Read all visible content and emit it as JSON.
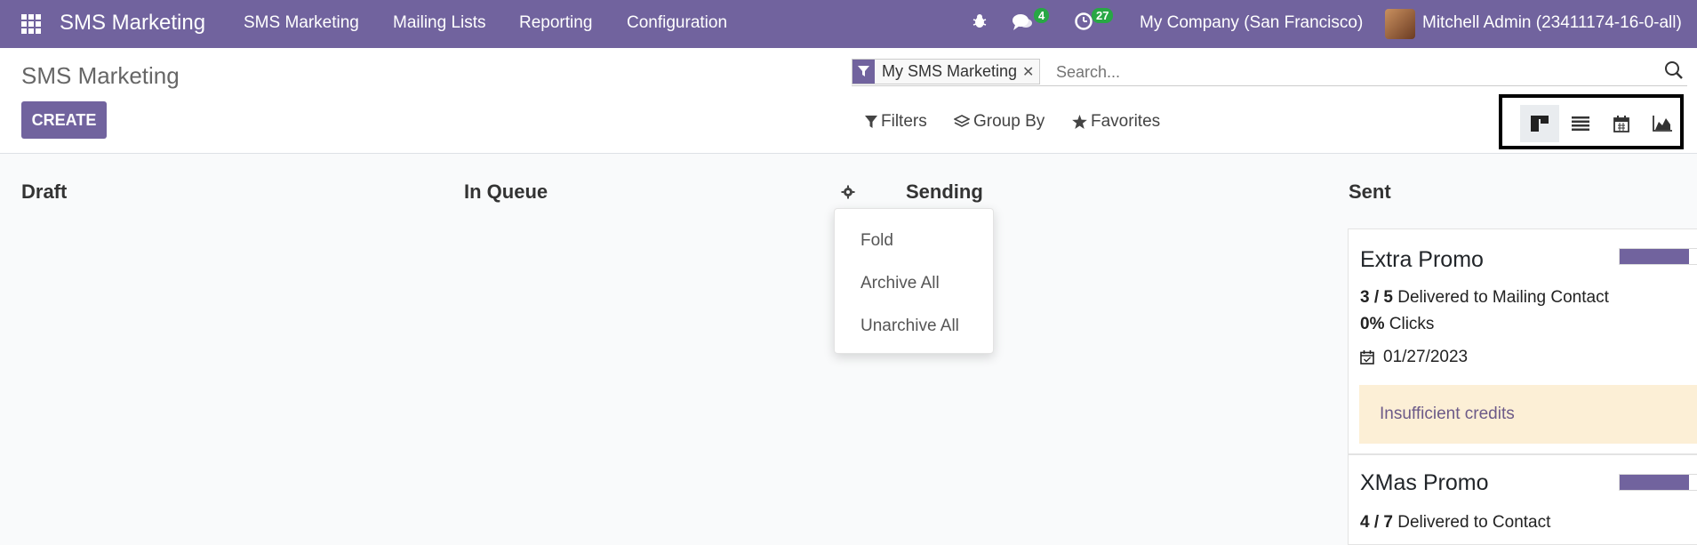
{
  "navbar": {
    "brand": "SMS Marketing",
    "menu": [
      "SMS Marketing",
      "Mailing Lists",
      "Reporting",
      "Configuration"
    ],
    "messages_count": "4",
    "activities_count": "27",
    "company": "My Company (San Francisco)",
    "user": "Mitchell Admin (23411174-16-0-all)"
  },
  "control": {
    "title": "SMS Marketing",
    "create_label": "CREATE",
    "facet_label": "My SMS Marketing",
    "search_placeholder": "Search...",
    "filters_label": "Filters",
    "groupby_label": "Group By",
    "favorites_label": "Favorites",
    "views": [
      "kanban-view-icon",
      "list-view-icon",
      "calendar-view-icon",
      "graph-view-icon"
    ]
  },
  "kanban": {
    "columns": [
      "Draft",
      "In Queue",
      "Sending",
      "Sent"
    ],
    "column_menu": [
      "Fold",
      "Archive All",
      "Unarchive All"
    ],
    "cards": [
      {
        "title": "Extra Promo",
        "progress": 0.87,
        "delivered": "3 / 5",
        "delivered_label": "Delivered to Mailing Contact",
        "clicks": "0%",
        "clicks_label": "Clicks",
        "date": "01/27/2023",
        "alert": "Insufficient credits"
      },
      {
        "title": "XMas Promo",
        "progress": 0.87,
        "delivered": "4 / 7",
        "delivered_label": "Delivered to Contact"
      }
    ]
  },
  "colors": {
    "primary": "#71639e",
    "badge": "#28a745",
    "alert_bg": "#fcefd6"
  }
}
